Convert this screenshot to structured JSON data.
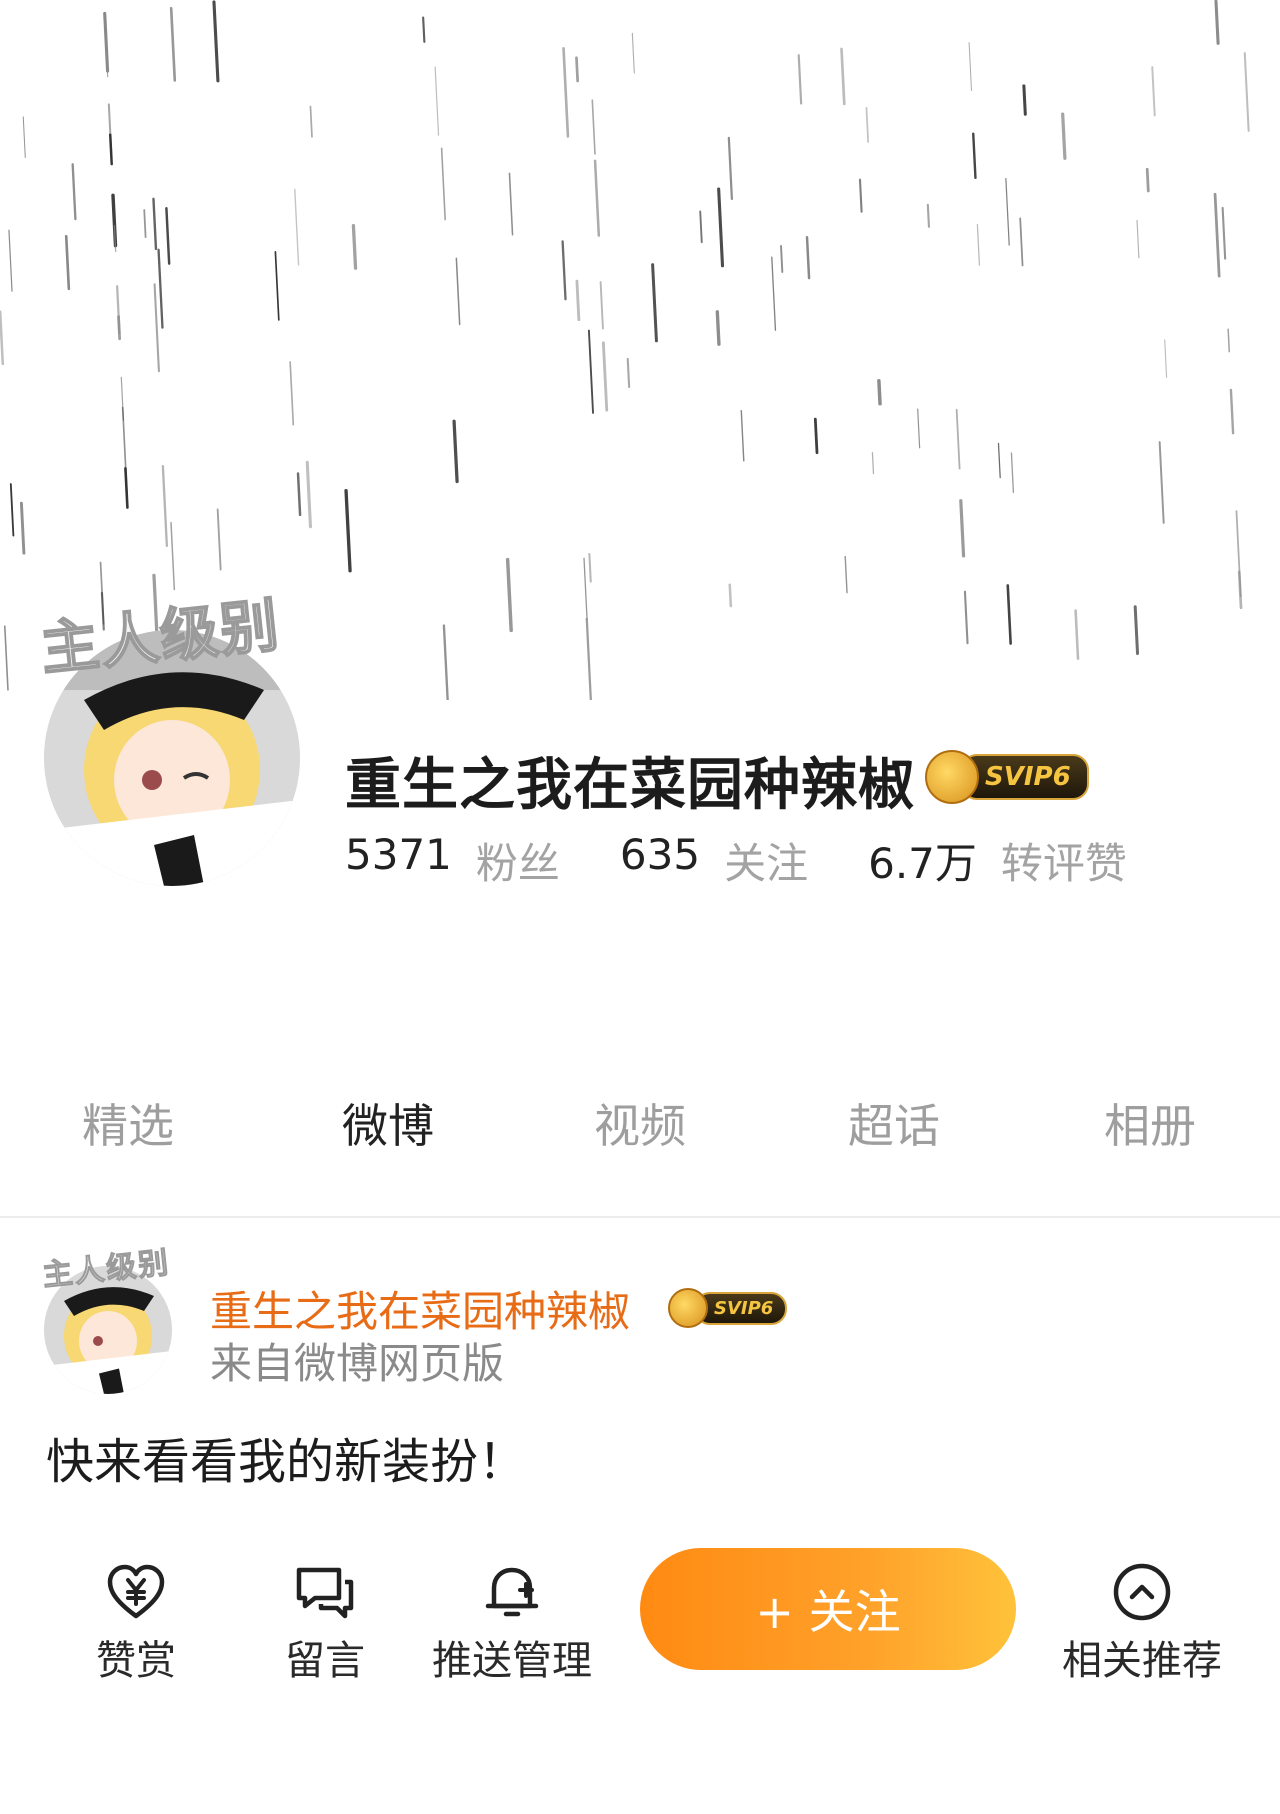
{
  "profile": {
    "name": "重生之我在菜园种辣椒",
    "avatar_frame_text": "主人级别",
    "vip_badge": "SVIP6",
    "stats": [
      {
        "value": "5371",
        "label": "粉丝"
      },
      {
        "value": "635",
        "label": "关注"
      },
      {
        "value": "6.7万",
        "label": "转评赞"
      }
    ]
  },
  "tabs": [
    {
      "label": "精选",
      "active": false
    },
    {
      "label": "微博",
      "active": true
    },
    {
      "label": "视频",
      "active": false
    },
    {
      "label": "超话",
      "active": false
    },
    {
      "label": "相册",
      "active": false
    }
  ],
  "post": {
    "author": "重生之我在菜园种辣椒",
    "vip_badge": "SVIP6",
    "source": "来自微博网页版",
    "text": "快来看看我的新装扮！"
  },
  "actions": {
    "reward": {
      "label": "赞赏",
      "icon": "heart-yuan-icon"
    },
    "message": {
      "label": "留言",
      "icon": "chat-bubbles-icon"
    },
    "push": {
      "label": "推送管理",
      "icon": "bell-plus-icon"
    },
    "follow": {
      "label": "+ 关注"
    },
    "related": {
      "label": "相关推荐",
      "icon": "chevron-up-circle-icon"
    }
  },
  "colors": {
    "accent_orange": "#ff8a12",
    "author_orange": "#e86b16",
    "muted_gray": "#a3a3a3"
  }
}
